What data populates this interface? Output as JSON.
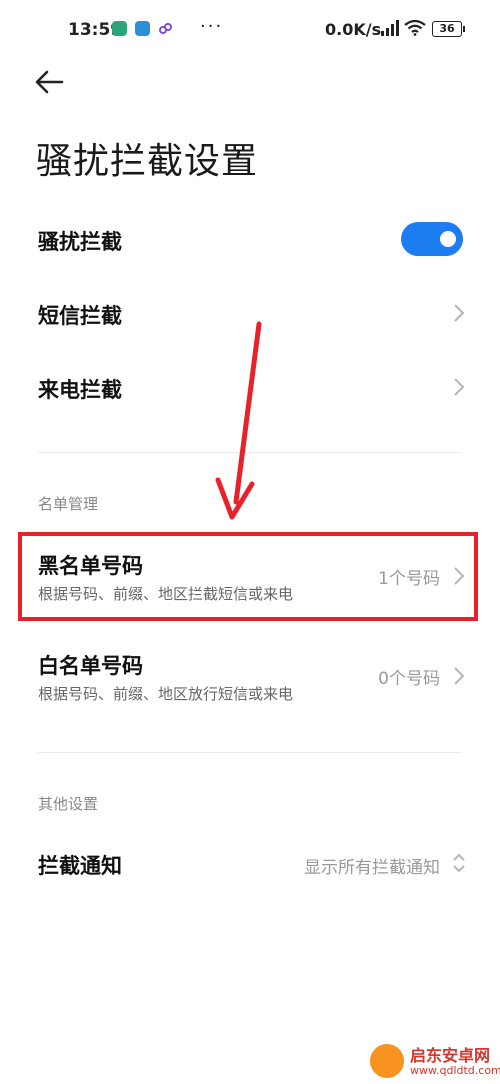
{
  "status_bar": {
    "time": "13:59",
    "dots": "···",
    "net_speed": "0.0K/s",
    "battery": "36"
  },
  "header": {
    "title": "骚扰拦截设置"
  },
  "main_settings": {
    "harassment_block": {
      "label": "骚扰拦截",
      "enabled": true
    },
    "sms_block": {
      "label": "短信拦截"
    },
    "call_block": {
      "label": "来电拦截"
    }
  },
  "list_management": {
    "section_label": "名单管理",
    "blacklist": {
      "title": "黑名单号码",
      "subtitle": "根据号码、前缀、地区拦截短信或来电",
      "count": "1个号码"
    },
    "whitelist": {
      "title": "白名单号码",
      "subtitle": "根据号码、前缀、地区放行短信或来电",
      "count": "0个号码"
    }
  },
  "other_settings": {
    "section_label": "其他设置",
    "intercept_notification": {
      "label": "拦截通知",
      "value": "显示所有拦截通知"
    }
  },
  "watermark": {
    "name": "启东安卓网",
    "url": "www.qdldtd.com"
  },
  "colors": {
    "toggle_on": "#1c7cf2",
    "annotation_red": "#e8222a"
  }
}
